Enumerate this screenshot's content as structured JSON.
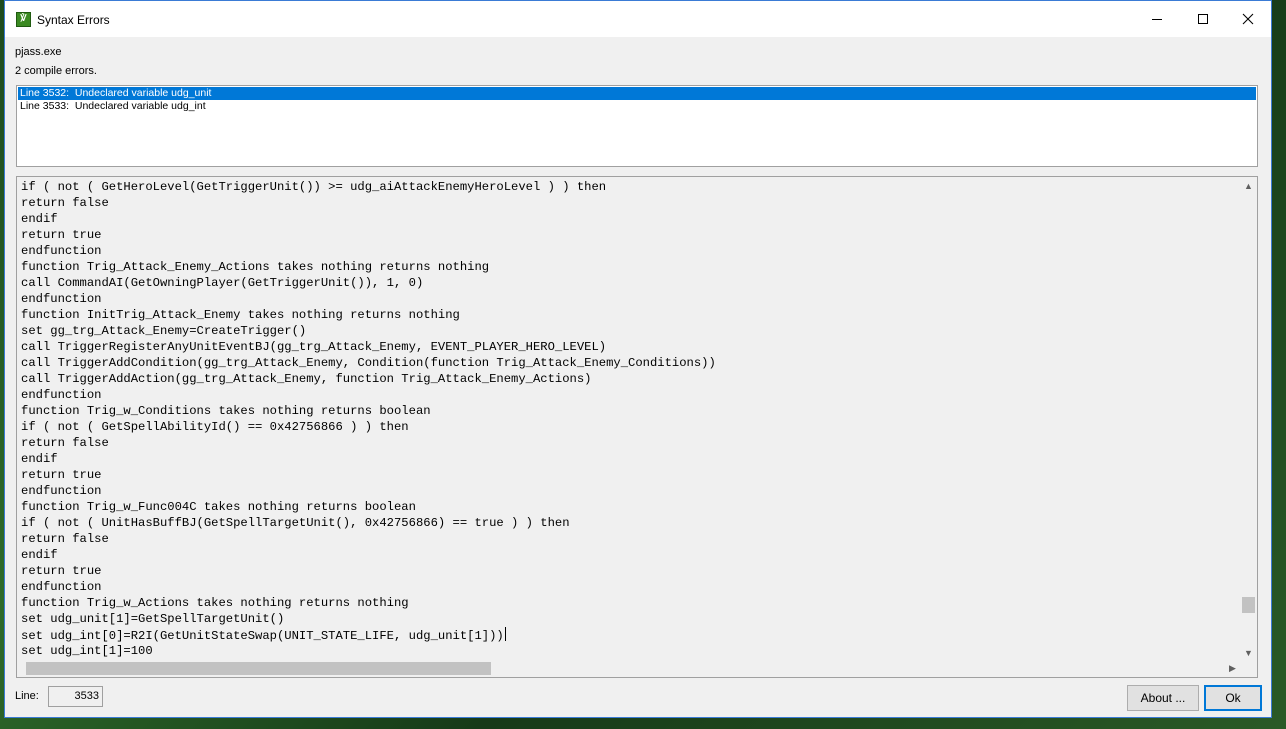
{
  "window": {
    "title": "Syntax Errors"
  },
  "info": {
    "tool": "pjass.exe",
    "summary": "2 compile errors."
  },
  "errors": [
    {
      "text": "Line 3532:  Undeclared variable udg_unit",
      "selected": true
    },
    {
      "text": "Line 3533:  Undeclared variable udg_int",
      "selected": false
    }
  ],
  "code_lines": [
    "if ( not ( GetHeroLevel(GetTriggerUnit()) >= udg_aiAttackEnemyHeroLevel ) ) then",
    "return false",
    "endif",
    "return true",
    "endfunction",
    "function Trig_Attack_Enemy_Actions takes nothing returns nothing",
    "call CommandAI(GetOwningPlayer(GetTriggerUnit()), 1, 0)",
    "endfunction",
    "function InitTrig_Attack_Enemy takes nothing returns nothing",
    "set gg_trg_Attack_Enemy=CreateTrigger()",
    "call TriggerRegisterAnyUnitEventBJ(gg_trg_Attack_Enemy, EVENT_PLAYER_HERO_LEVEL)",
    "call TriggerAddCondition(gg_trg_Attack_Enemy, Condition(function Trig_Attack_Enemy_Conditions))",
    "call TriggerAddAction(gg_trg_Attack_Enemy, function Trig_Attack_Enemy_Actions)",
    "endfunction",
    "function Trig_w_Conditions takes nothing returns boolean",
    "if ( not ( GetSpellAbilityId() == 0x42756866 ) ) then",
    "return false",
    "endif",
    "return true",
    "endfunction",
    "function Trig_w_Func004C takes nothing returns boolean",
    "if ( not ( UnitHasBuffBJ(GetSpellTargetUnit(), 0x42756866) == true ) ) then",
    "return false",
    "endif",
    "return true",
    "endfunction",
    "function Trig_w_Actions takes nothing returns nothing",
    "set udg_unit[1]=GetSpellTargetUnit()",
    "set udg_int[0]=R2I(GetUnitStateSwap(UNIT_STATE_LIFE, udg_unit[1]))",
    "set udg_int[1]=100"
  ],
  "caret_line_index": 28,
  "footer": {
    "line_label": "Line:",
    "line_value": "3533",
    "about_label": "About ...",
    "ok_label": "Ok"
  },
  "icons": {
    "app": "jass-app-icon",
    "minimize": "minimize-icon",
    "maximize": "maximize-icon",
    "close": "close-icon"
  },
  "colors": {
    "selection": "#0078d7",
    "default_button_border": "#0078d7"
  }
}
